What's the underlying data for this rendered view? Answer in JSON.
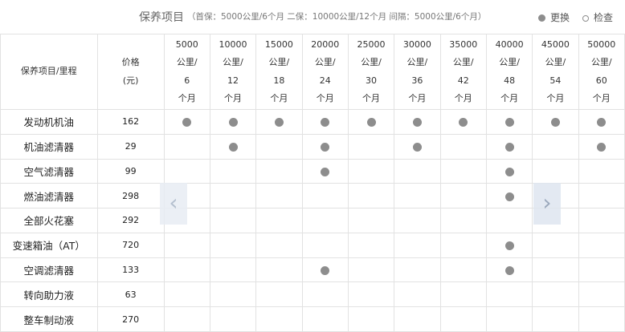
{
  "header": {
    "title": "保养项目",
    "note": "（首保：5000公里/6个月 二保：10000公里/12个月  间隔：5000公里/6个月）",
    "legend": [
      {
        "icon": "filled-dot",
        "label": "更换"
      },
      {
        "icon": "hollow-dot",
        "label": "检查"
      }
    ]
  },
  "table": {
    "item_header": "保养项目/里程",
    "price_header": [
      "价格",
      "(元)"
    ],
    "intervals": [
      [
        "5000",
        "公里/",
        "6",
        "个月"
      ],
      [
        "10000",
        "公里/",
        "12",
        "个月"
      ],
      [
        "15000",
        "公里/",
        "18",
        "个月"
      ],
      [
        "20000",
        "公里/",
        "24",
        "个月"
      ],
      [
        "25000",
        "公里/",
        "30",
        "个月"
      ],
      [
        "30000",
        "公里/",
        "36",
        "个月"
      ],
      [
        "35000",
        "公里/",
        "42",
        "个月"
      ],
      [
        "40000",
        "公里/",
        "48",
        "个月"
      ],
      [
        "45000",
        "公里/",
        "54",
        "个月"
      ],
      [
        "50000",
        "公里/",
        "60",
        "个月"
      ]
    ],
    "rows": [
      {
        "name": "发动机机油",
        "price": "162",
        "marks": [
          1,
          1,
          1,
          1,
          1,
          1,
          1,
          1,
          1,
          1
        ]
      },
      {
        "name": "机油滤清器",
        "price": "29",
        "marks": [
          0,
          1,
          0,
          1,
          0,
          1,
          0,
          1,
          0,
          1
        ]
      },
      {
        "name": "空气滤清器",
        "price": "99",
        "marks": [
          0,
          0,
          0,
          1,
          0,
          0,
          0,
          1,
          0,
          0
        ]
      },
      {
        "name": "燃油滤清器",
        "price": "298",
        "marks": [
          0,
          0,
          0,
          0,
          0,
          0,
          0,
          1,
          0,
          0
        ]
      },
      {
        "name": "全部火花塞",
        "price": "292",
        "marks": [
          0,
          0,
          0,
          0,
          0,
          0,
          0,
          0,
          0,
          0
        ]
      },
      {
        "name": "变速箱油（AT）",
        "price": "720",
        "marks": [
          0,
          0,
          0,
          0,
          0,
          0,
          0,
          1,
          0,
          0
        ]
      },
      {
        "name": "空调滤清器",
        "price": "133",
        "marks": [
          0,
          0,
          0,
          1,
          0,
          0,
          0,
          1,
          0,
          0
        ]
      },
      {
        "name": "转向助力液",
        "price": "63",
        "marks": [
          0,
          0,
          0,
          0,
          0,
          0,
          0,
          0,
          0,
          0
        ]
      },
      {
        "name": "整车制动液",
        "price": "270",
        "marks": [
          0,
          0,
          0,
          0,
          0,
          0,
          0,
          0,
          0,
          0
        ]
      }
    ]
  },
  "nav": {
    "prev_icon": "chevron-left-icon",
    "next_icon": "chevron-right-icon"
  },
  "colors": {
    "mark": "#8d8d8d",
    "border": "#e2e2e2",
    "arrow_bg": "#e8edf4"
  }
}
